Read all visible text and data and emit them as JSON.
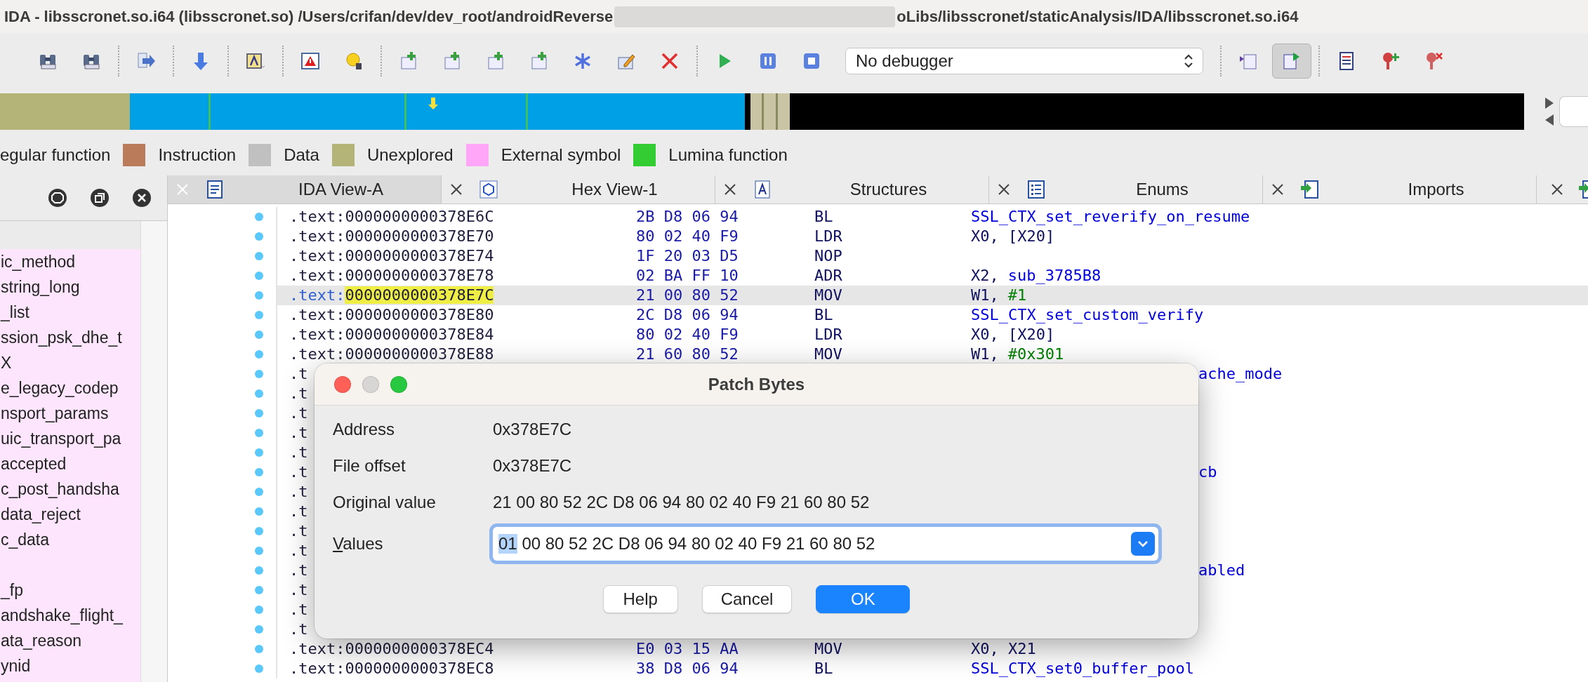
{
  "window": {
    "title_start": "IDA - libsscronet.so.i64 (libsscronet.so) /Users/crifan/dev/dev_root/androidReverse",
    "title_end": "oLibs/libsscronet/staticAnalysis/IDA/libsscronet.so.i64"
  },
  "toolbar": {
    "buttons": [
      {
        "pressed": false
      },
      {
        "pressed": false
      },
      {
        "pressed": false
      },
      {
        "pressed": false
      },
      {
        "pressed": false
      },
      {
        "pressed": false
      },
      {
        "pressed": false
      },
      {
        "pressed": false
      },
      {
        "pressed": false
      },
      {
        "pressed": false
      },
      {
        "pressed": false
      },
      {
        "pressed": false
      },
      {
        "pressed": false
      },
      {
        "pressed": false
      },
      {
        "pressed": false
      },
      {
        "pressed": false
      },
      {
        "pressed": false
      }
    ],
    "debugger": "No debugger",
    "buttons_after": [
      {
        "pressed": false
      },
      {
        "pressed": true
      },
      {
        "pressed": false
      },
      {
        "pressed": false
      },
      {
        "pressed": false
      }
    ]
  },
  "legend": [
    {
      "label": "egular function"
    },
    {
      "label": "Instruction",
      "color": "#b97b5a"
    },
    {
      "label": "Data",
      "color": "#c0c0c0"
    },
    {
      "label": "Unexplored",
      "color": "#b4b478"
    },
    {
      "label": "External symbol",
      "color": "#ffa6f8"
    },
    {
      "label": "Lumina function",
      "color": "#33cc33"
    }
  ],
  "sidebar": {
    "items": [
      {
        "label": "ic_method"
      },
      {
        "label": "string_long"
      },
      {
        "label": "_list"
      },
      {
        "label": "ssion_psk_dhe_t"
      },
      {
        "label": "X"
      },
      {
        "label": "e_legacy_codep"
      },
      {
        "label": "nsport_params"
      },
      {
        "label": "uic_transport_pa"
      },
      {
        "label": "accepted"
      },
      {
        "label": "c_post_handsha"
      },
      {
        "label": "data_reject"
      },
      {
        "label": "c_data"
      },
      {
        "label": "_fp",
        "gap_before": true
      },
      {
        "label": "andshake_flight_"
      },
      {
        "label": "ata_reason"
      },
      {
        "label": "ynid"
      }
    ]
  },
  "tabs": [
    {
      "label": "IDA View-A",
      "selected": true
    },
    {
      "label": "Hex View-1",
      "selected": false
    },
    {
      "label": "Structures",
      "selected": false
    },
    {
      "label": "Enums",
      "selected": false
    },
    {
      "label": "Imports",
      "selected": false
    }
  ],
  "code": {
    "rows": [
      {
        "kind": "full",
        "selected": false,
        "segment": ".text:",
        "address": "0000000000378E6C",
        "bytes": "2B D8 06 94",
        "mnemonic": "BL",
        "symbol": "SSL_CTX_set_reverify_on_resume"
      },
      {
        "kind": "full",
        "selected": false,
        "segment": ".text:",
        "address": "0000000000378E70",
        "bytes": "80 02 40 F9",
        "mnemonic": "LDR",
        "operand": "X0, [X20]"
      },
      {
        "kind": "full",
        "selected": false,
        "segment": ".text:",
        "address": "0000000000378E74",
        "bytes": "1F 20 03 D5",
        "mnemonic": "NOP"
      },
      {
        "kind": "full",
        "selected": false,
        "segment": ".text:",
        "address": "0000000000378E78",
        "bytes": "02 BA FF 10",
        "mnemonic": "ADR",
        "operand": "X2,",
        "symbol": "sub_3785B8"
      },
      {
        "kind": "full",
        "selected": true,
        "segment": ".text:",
        "address": "0000000000378E7C",
        "bytes": "21 00 80 52",
        "mnemonic": "MOV",
        "operand": "W1,",
        "immediate": "#1"
      },
      {
        "kind": "full",
        "selected": false,
        "segment": ".text:",
        "address": "0000000000378E80",
        "bytes": "2C D8 06 94",
        "mnemonic": "BL",
        "symbol": "SSL_CTX_set_custom_verify"
      },
      {
        "kind": "full",
        "selected": false,
        "segment": ".text:",
        "address": "0000000000378E84",
        "bytes": "80 02 40 F9",
        "mnemonic": "LDR",
        "operand": "X0, [X20]"
      },
      {
        "kind": "full",
        "selected": false,
        "segment": ".text:",
        "address": "0000000000378E88",
        "bytes": "21 60 80 52",
        "mnemonic": "MOV",
        "operand": "W1,",
        "immediate": "#0x301"
      },
      {
        "kind": "covered",
        "selected": false,
        "visible_start": ".t",
        "visible_end": "ache_mode"
      },
      {
        "kind": "covered",
        "selected": false,
        "visible_start": ".t"
      },
      {
        "kind": "covered",
        "selected": false,
        "visible_start": ".t"
      },
      {
        "kind": "covered",
        "selected": false,
        "visible_start": ".t"
      },
      {
        "kind": "covered",
        "selected": false,
        "visible_start": ".t"
      },
      {
        "kind": "covered",
        "selected": false,
        "visible_start": ".t",
        "visible_end": "cb"
      },
      {
        "kind": "covered",
        "selected": false,
        "visible_start": ".t"
      },
      {
        "kind": "covered",
        "selected": false,
        "visible_start": ".t"
      },
      {
        "kind": "covered",
        "selected": false,
        "visible_start": ".t"
      },
      {
        "kind": "covered",
        "selected": false,
        "visible_start": ".t"
      },
      {
        "kind": "covered",
        "selected": false,
        "visible_start": ".t",
        "visible_end": "abled"
      },
      {
        "kind": "covered",
        "selected": false,
        "visible_start": ".t"
      },
      {
        "kind": "covered",
        "selected": false,
        "visible_start": ".t"
      },
      {
        "kind": "covered",
        "selected": false,
        "visible_start": ".t"
      },
      {
        "kind": "full",
        "selected": false,
        "segment": ".text:",
        "address": "0000000000378EC4",
        "bytes": "E0 03 15 AA",
        "mnemonic": "MOV",
        "operand": "X0, X21"
      },
      {
        "kind": "full",
        "selected": false,
        "segment": ".text:",
        "address": "0000000000378EC8",
        "bytes": "38 D8 06 94",
        "mnemonic": "BL",
        "symbol": "SSL_CTX_set0_buffer_pool"
      }
    ]
  },
  "dialog": {
    "title": "Patch Bytes",
    "fields": [
      {
        "label": "Address",
        "value": "0x378E7C"
      },
      {
        "label": "File offset",
        "value": "0x378E7C"
      },
      {
        "label": "Original value",
        "value": "21 00 80 52 2C D8 06 94 80 02 40 F9 21 60 80 52"
      }
    ],
    "values": {
      "label": "Values",
      "selected_text": "01",
      "text": "00 80 52 2C D8 06 94 80 02 40 F9 21 60 80 52"
    },
    "buttons": [
      {
        "label": "Help",
        "default": false
      },
      {
        "label": "Cancel",
        "default": false
      },
      {
        "label": "OK",
        "default": true
      }
    ]
  }
}
